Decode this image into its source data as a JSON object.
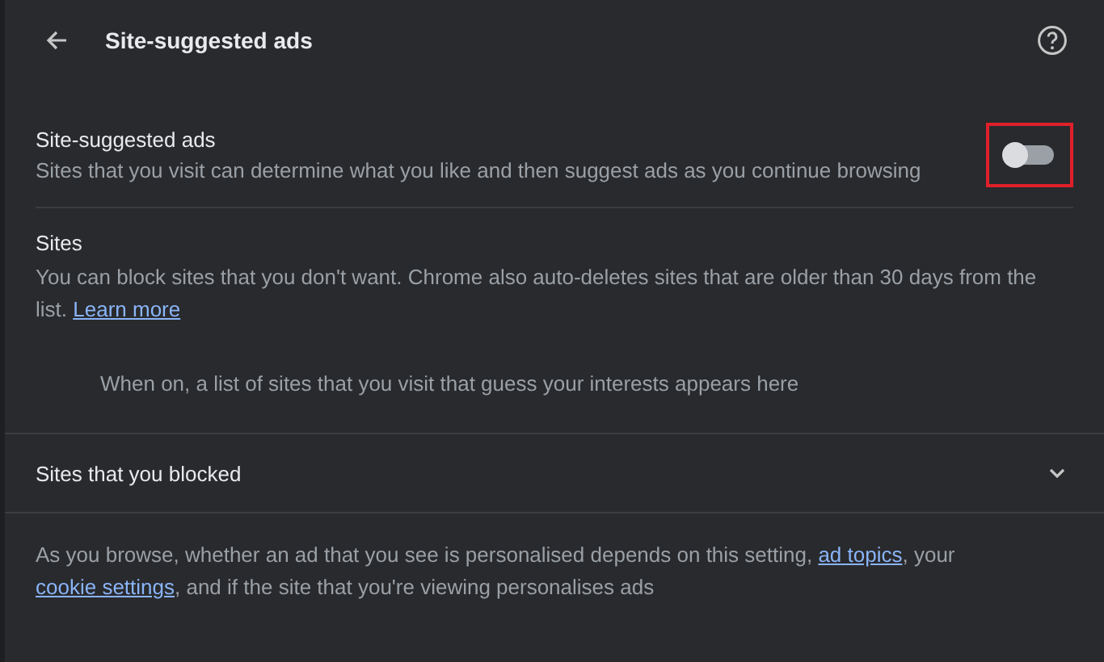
{
  "header": {
    "title": "Site-suggested ads"
  },
  "setting": {
    "label": "Site-suggested ads",
    "description": "Sites that you visit can determine what you like and then suggest ads as you continue browsing",
    "on": false,
    "highlighted": true
  },
  "sites": {
    "heading": "Sites",
    "description": "You can block sites that you don't want. Chrome also auto-deletes sites that are older than 30 days from the list.",
    "link": "Learn more",
    "empty_message": "When on, a list of sites that you visit that guess your interests appears here"
  },
  "blocked": {
    "label": "Sites that you blocked",
    "expanded": false
  },
  "footer": {
    "parts": [
      {
        "kind": "text",
        "text": "As you browse, whether an ad that you see is personalised depends on this setting, "
      },
      {
        "kind": "link",
        "text": "ad topics"
      },
      {
        "kind": "text",
        "text": ", your "
      },
      {
        "kind": "link",
        "text": "cookie settings"
      },
      {
        "kind": "text",
        "text": ", and if the site that you're viewing personalises ads"
      }
    ]
  }
}
